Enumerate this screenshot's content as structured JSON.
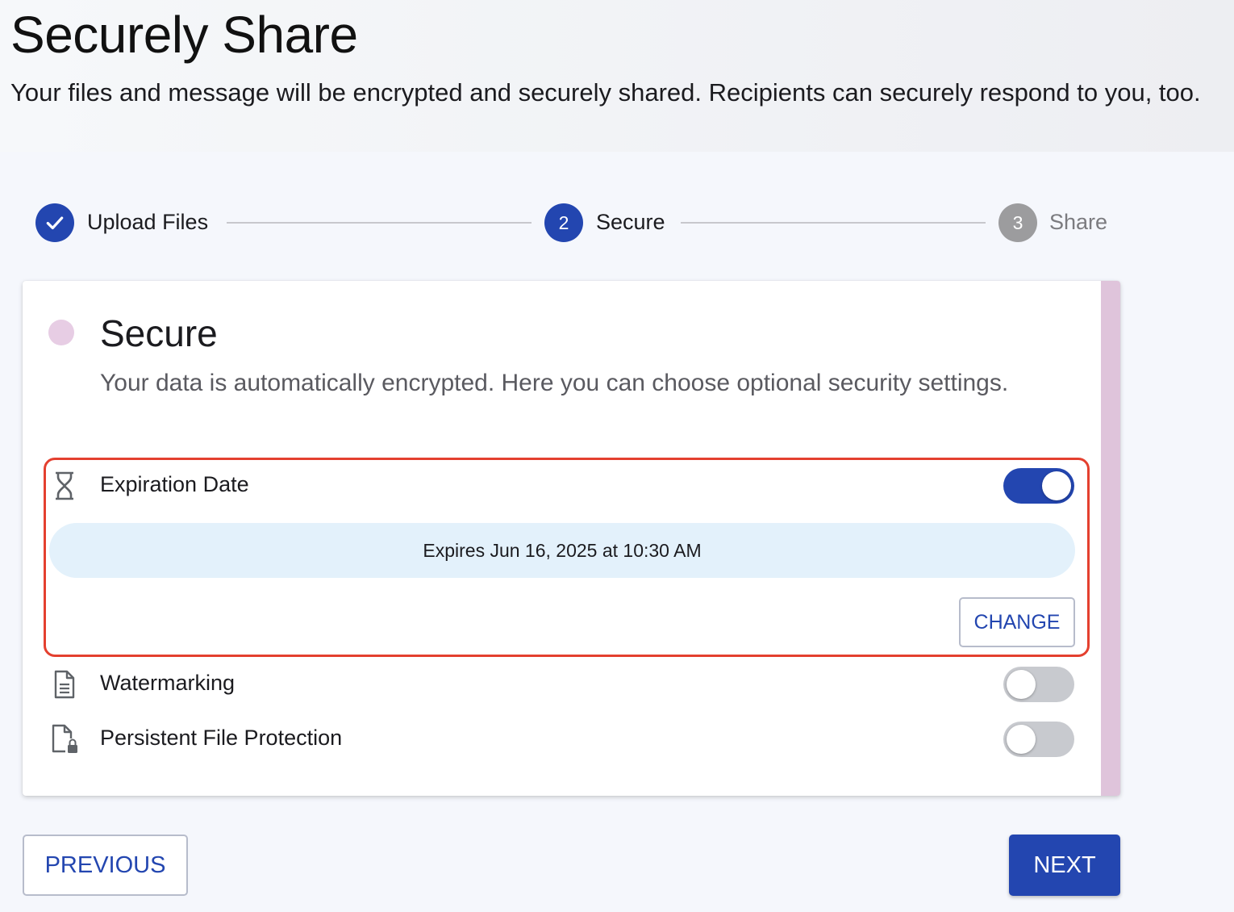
{
  "header": {
    "title": "Securely Share",
    "subtitle": "Your files and message will be encrypted and securely shared. Recipients can securely respond to you, too."
  },
  "stepper": {
    "steps": [
      {
        "number": "",
        "label": "Upload Files",
        "state": "completed"
      },
      {
        "number": "2",
        "label": "Secure",
        "state": "active"
      },
      {
        "number": "3",
        "label": "Share",
        "state": "pending"
      }
    ]
  },
  "card": {
    "title": "Secure",
    "description": "Your data is automatically encrypted. Here you can choose optional security settings.",
    "accent_color": "#dfc4db",
    "settings": [
      {
        "label": "Expiration Date",
        "icon": "hourglass-icon",
        "enabled": true
      },
      {
        "label": "Watermarking",
        "icon": "document-icon",
        "enabled": false
      },
      {
        "label": "Persistent File Protection",
        "icon": "file-lock-icon",
        "enabled": false
      }
    ],
    "expiration": {
      "text": "Expires Jun 16, 2025 at 10:30 AM",
      "change_label": "CHANGE"
    }
  },
  "footer": {
    "previous_label": "PREVIOUS",
    "next_label": "NEXT"
  },
  "colors": {
    "primary": "#2346b0",
    "highlight_border": "#e4402f",
    "pill_bg": "#e3f1fb"
  }
}
